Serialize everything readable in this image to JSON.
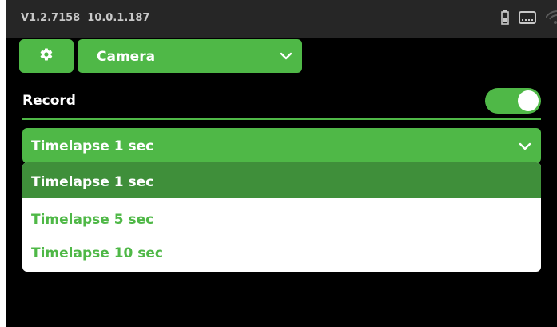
{
  "status_bar": {
    "version": "V1.2.7158",
    "ip": "10.0.1.187",
    "icons": [
      "battery-icon",
      "display-icon",
      "wifi-icon"
    ]
  },
  "toolbar": {
    "settings_icon": "gear-icon",
    "mode_select": {
      "value": "Camera",
      "icon": "chevron-down-icon"
    }
  },
  "record": {
    "label": "Record",
    "toggle_on": true
  },
  "timelapse": {
    "selected": "Timelapse 1 sec",
    "options": [
      "Timelapse 1 sec",
      "Timelapse 5 sec",
      "Timelapse 10 sec"
    ],
    "highlighted_index": 0
  },
  "colors": {
    "accent": "#4fb847",
    "accent_dark": "#3f8f3a",
    "status_bar_bg": "#262626",
    "background": "#000000"
  }
}
